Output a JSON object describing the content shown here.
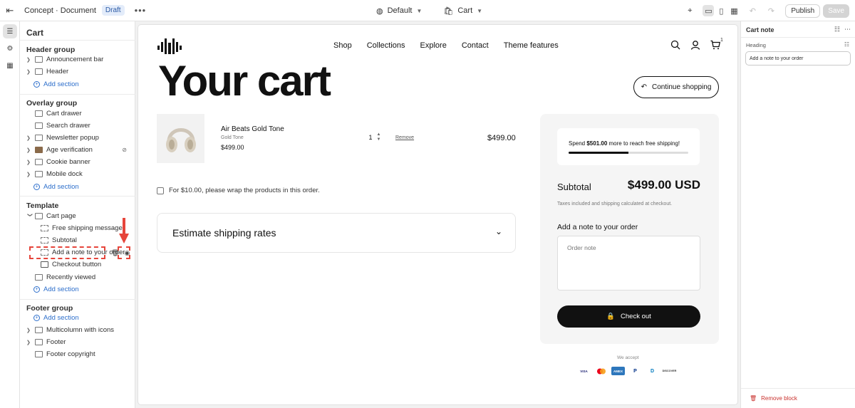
{
  "topbar": {
    "breadcrumb": "Concept · Document",
    "status_badge": "Draft",
    "more": "•••",
    "theme_select": "Default",
    "page_select": "Cart",
    "publish_label": "Publish",
    "save_label": "Save"
  },
  "sidebar": {
    "title": "Cart",
    "header_group": {
      "title": "Header group",
      "items": [
        "Announcement bar",
        "Header"
      ],
      "add": "Add section"
    },
    "overlay_group": {
      "title": "Overlay group",
      "items": [
        "Cart drawer",
        "Search drawer",
        "Newsletter popup",
        "Age verification",
        "Cookie banner",
        "Mobile dock"
      ],
      "add": "Add section"
    },
    "template": {
      "title": "Template",
      "section": "Cart page",
      "blocks": [
        "Free shipping message",
        "Subtotal",
        "Add a note to your order",
        "Checkout button"
      ],
      "after": "Recently viewed",
      "add": "Add section"
    },
    "footer_group": {
      "title": "Footer group",
      "add": "Add section",
      "items": [
        "Multicolumn with icons",
        "Footer",
        "Footer copyright"
      ]
    }
  },
  "preview": {
    "nav": [
      "Shop",
      "Collections",
      "Explore",
      "Contact",
      "Theme features"
    ],
    "cart_count": "1",
    "heading": "Your cart",
    "continue_label": "Continue shopping",
    "item": {
      "name": "Air Beats Gold Tone",
      "variant": "Gold Tone",
      "price": "$499.00",
      "qty": "1",
      "remove": "Remove",
      "line_total": "$499.00"
    },
    "gift_wrap": "For $10.00, please wrap the products in this order.",
    "shipping_title": "Estimate shipping rates",
    "free_shipping": {
      "prefix": "Spend ",
      "amount": "$501.00",
      "suffix": " more to reach free shipping!",
      "progress": 0.5
    },
    "subtotal_label": "Subtotal",
    "subtotal_value": "$499.00 USD",
    "taxes": "Taxes included and shipping calculated at checkout.",
    "note_label": "Add a note to your order",
    "note_placeholder": "Order note",
    "checkout_label": "Check out",
    "we_accept": "We accept",
    "payments": [
      "VISA",
      "MC",
      "AMEX",
      "P",
      "D",
      "DISCOVER"
    ]
  },
  "right_panel": {
    "title": "Cart note",
    "field_label": "Heading",
    "field_value": "Add a note to your order",
    "remove_label": "Remove block"
  },
  "colors": {
    "accent": "#2c6ecb",
    "highlight": "#e6453b",
    "danger": "#c9302c"
  }
}
